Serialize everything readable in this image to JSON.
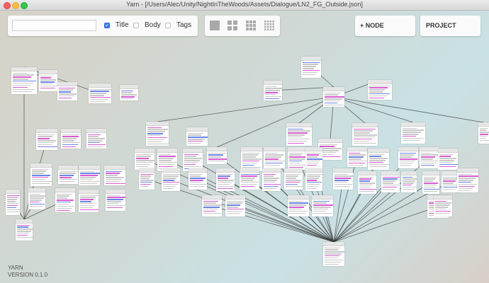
{
  "window": {
    "title": "Yarn - [/Users/Alec/Unity/NightInTheWoods/Assets/Dialogue/LN2_FG_Outside.json]"
  },
  "toolbar": {
    "search_value": "",
    "filters": [
      {
        "label": "Title",
        "checked": true
      },
      {
        "label": "Body",
        "checked": false
      },
      {
        "label": "Tags",
        "checked": false
      }
    ],
    "zoom_levels": [
      "zoom-1",
      "zoom-2",
      "zoom-3",
      "zoom-4"
    ],
    "add_node_label": "+ NODE",
    "project_label": "PROJECT"
  },
  "brand": {
    "name": "YARN",
    "version": "VERSION 0.1.0"
  }
}
